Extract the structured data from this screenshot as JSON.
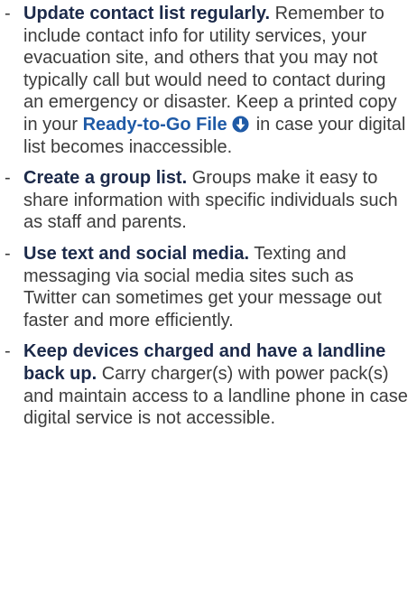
{
  "items": [
    {
      "heading": "Update contact list regularly.",
      "text_before_link": " Remember to include contact info for utility services, your evacuation site, and others that you may not typically call but would need to contact during an emergency or disaster. Keep a printed copy in your ",
      "link": "Ready-to-Go File",
      "link_icon": "download-arrow-icon",
      "text_after_link": " in case your digital  list becomes inaccessible."
    },
    {
      "heading": "Create a group list.",
      "text": " Groups make it easy to share information with specific individuals such as staff and parents."
    },
    {
      "heading": "Use text and social media.",
      "text": " Texting and messaging via social media sites such as Twitter can sometimes get your message out faster and more efficiently."
    },
    {
      "heading": "Keep devices charged and have a landline back up.",
      "text": " Carry charger(s) with power pack(s) and maintain access to a landline phone in case digital service is not accessible."
    }
  ],
  "bullet": "-",
  "colors": {
    "body_text": "#3c3c3c",
    "heading_text": "#1c2a4a",
    "link": "#1f5aa6"
  }
}
